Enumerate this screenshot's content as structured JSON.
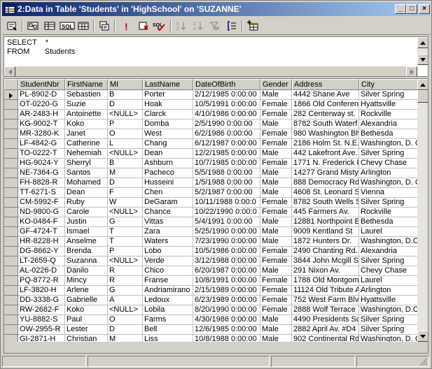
{
  "window": {
    "title": "2:Data in Table 'Students' in 'HighSchool' on 'SUZANNE'"
  },
  "caption_buttons": {
    "minimize": "_",
    "maximize": "□",
    "close": "×"
  },
  "toolbar": {
    "buttons": [
      {
        "name": "properties-icon"
      },
      {
        "name": "show-diagram-pane-icon"
      },
      {
        "name": "show-grid-pane-icon"
      },
      {
        "name": "show-sql-pane-icon",
        "label": "SQL"
      },
      {
        "name": "show-results-pane-icon"
      },
      {
        "name": "change-query-type-icon"
      },
      {
        "name": "run-icon",
        "label": "!"
      },
      {
        "name": "cancel-query-icon"
      },
      {
        "name": "verify-sql-icon",
        "label": "SQL"
      },
      {
        "name": "sort-ascending-icon"
      },
      {
        "name": "sort-descending-icon"
      },
      {
        "name": "remove-filter-icon"
      },
      {
        "name": "group-by-icon"
      },
      {
        "name": "add-table-icon"
      }
    ]
  },
  "sql": {
    "line1": "SELECT    *",
    "line2": "FROM       Students"
  },
  "grid": {
    "columns": [
      "StudentNbr",
      "FirstName",
      "MI",
      "LastName",
      "DateOfBirth",
      "Gender",
      "Address",
      "City"
    ],
    "rows": [
      [
        "PL-8902-D",
        "Sebastien",
        "B",
        "Porter",
        "2/12/1985 0:00:00",
        "Male",
        "4442 Shane Ave",
        "Silver Spring"
      ],
      [
        "OT-0220-G",
        "Suzie",
        "D",
        "Hoak",
        "10/5/1991 0:00:00",
        "Female",
        "1866 Old Conferen",
        "Hyattsville"
      ],
      [
        "AR-2483-H",
        "Antoinette",
        "<NULL>",
        "Clarck",
        "4/10/1986 0:00:00",
        "Female",
        "282 Centerway st.",
        "Rockville"
      ],
      [
        "KG-9002-T",
        "Koko",
        "P",
        "Domba",
        "2/5/1990 0:00:00",
        "Male",
        "8782 South Waterf",
        "Alexandria"
      ],
      [
        "MR-3280-K",
        "Janet",
        "O",
        "West",
        "6/2/1986 0:00:00",
        "Female",
        "980 Washington Blv",
        "Bethesda"
      ],
      [
        "LF-4842-G",
        "Catherine",
        "L",
        "Chang",
        "6/12/1987 0:00:00",
        "Female",
        "2186 Holm St. N.E.",
        "Washington, D. C"
      ],
      [
        "TO-0222-T",
        "Nehemiah",
        "<NULL>",
        "Dean",
        "12/2/1985 0:00:00",
        "Male",
        "442 Lakefront Ave.",
        "Silver Spring"
      ],
      [
        "HG-9024-Y",
        "Sherryl",
        "B",
        "Ashburn",
        "10/7/1985 0:00:00",
        "Female",
        "1771 N. Frederick P",
        "Chevy Chase"
      ],
      [
        "NE-7364-G",
        "Santos",
        "M",
        "Pacheco",
        "5/5/1988 0:00:00",
        "Male",
        "14277 Grand Misty",
        "Arlington"
      ],
      [
        "FH-8828-R",
        "Mohamed",
        "D",
        "Husseini",
        "1/5/1988 0:00:00",
        "Male",
        "888 Democracy Rd",
        "Washington, D. C"
      ],
      [
        "TT-6271-S",
        "Dean",
        "F",
        "Chen",
        "5/2/1987 0:00:00",
        "Male",
        "4608 St. Leonard S",
        "Vienna"
      ],
      [
        "CM-5992-F",
        "Ruby",
        "W",
        "DeGaram",
        "10/11/1988 0:00:0",
        "Female",
        "8782 South Wells S",
        "Silver Spring"
      ],
      [
        "ND-9800-G",
        "Carole",
        "<NULL>",
        "Chance",
        "10/22/1990 0:00:0",
        "Female",
        "445 Farmers Av.",
        "Rockville"
      ],
      [
        "KO-0484-F",
        "Justin",
        "G",
        "Vittas",
        "5/4/1991 0:00:00",
        "Male",
        "12881 Northpoint E",
        "Bethesda"
      ],
      [
        "GF-4724-T",
        "Ismael",
        "T",
        "Zara",
        "5/25/1990 0:00:00",
        "Male",
        "9009 Kentland St",
        "Laurel"
      ],
      [
        "HR-8228-H",
        "Anselme",
        "T",
        "Waters",
        "7/23/1990 0:00:00",
        "Male",
        "1872 Hunters Dr.",
        "Washington, D.C"
      ],
      [
        "DG-8662-Y",
        "Brenda",
        "P",
        "Lobo",
        "10/5/1986 0:00:00",
        "Female",
        "2490 Chanting Rd.",
        "Alexandria"
      ],
      [
        "LT-2659-Q",
        "Suzanna",
        "<NULL>",
        "Verde",
        "3/12/1988 0:00:00",
        "Female",
        "3844 John Mcgill St",
        "Silver Spring"
      ],
      [
        "AL-0226-D",
        "Danilo",
        "R",
        "Chico",
        "6/20/1987 0:00:00",
        "Male",
        "291 Nixon Av.",
        "Chevy Chase"
      ],
      [
        "PQ-8772-R",
        "Mincy",
        "R",
        "Franse",
        "10/8/1991 0:00:00",
        "Female",
        "1788 Old Montgome",
        "Laurel"
      ],
      [
        "LF-3820-H",
        "Arlene",
        "G",
        "Andriamirano",
        "2/15/1989 0:00:00",
        "Female",
        "11124 Old Tribute A",
        "Arlington"
      ],
      [
        "DD-3338-G",
        "Gabrielle",
        "A",
        "Ledoux",
        "6/23/1989 0:00:00",
        "Female",
        "752 West Farm Blvc",
        "Hyattsville"
      ],
      [
        "RW-2682-F",
        "Koko",
        "<NULL>",
        "Lobila",
        "8/20/1990 0:00:00",
        "Female",
        "2888 Wolf Terrace",
        "Washington, D.C"
      ],
      [
        "YU-8882-S",
        "Paul",
        "O",
        "Farms",
        "4/30/1986 0:00:00",
        "Male",
        "4490 Presidents Sq",
        "Silver Spring"
      ],
      [
        "OW-2955-R",
        "Lester",
        "D",
        "Bell",
        "12/6/1985 0:00:00",
        "Male",
        "2882 April Av. #D4",
        "Silver Spring"
      ],
      [
        "GI-2871-H",
        "Christian",
        "M",
        "Liss",
        "10/8/1988 0:00:00",
        "Male",
        "902 Continental Rd",
        "Washington, D. C"
      ]
    ]
  },
  "status": {
    "items": [
      "",
      "",
      "",
      ""
    ]
  }
}
